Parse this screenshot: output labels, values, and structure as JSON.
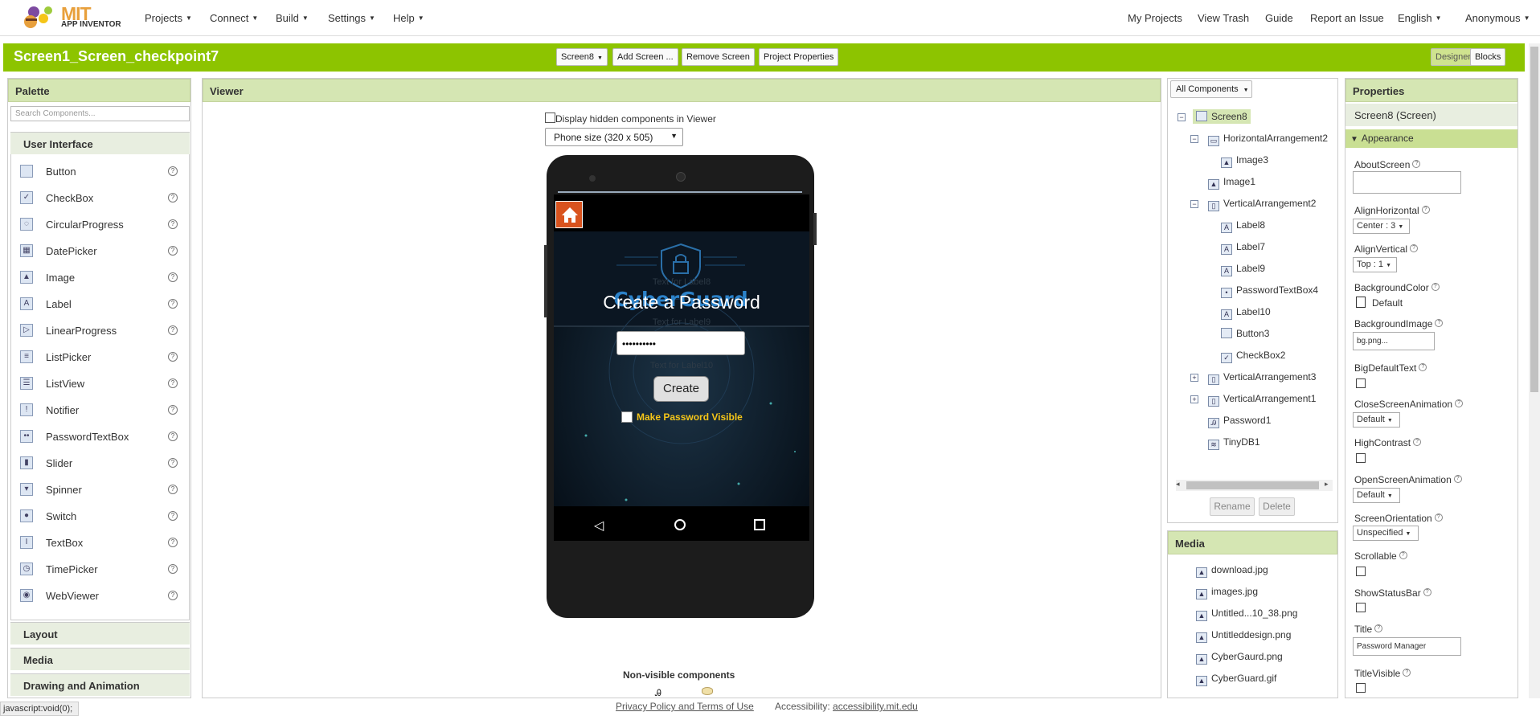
{
  "header": {
    "logo_mit": "MIT",
    "logo_subtitle": "APP INVENTOR",
    "menus": [
      "Projects",
      "Connect",
      "Build",
      "Settings",
      "Help"
    ],
    "right_links": [
      "My Projects",
      "View Trash",
      "Guide",
      "Report an Issue"
    ],
    "language": "English",
    "user": "Anonymous"
  },
  "project": {
    "title": "Screen1_Screen_checkpoint7",
    "screen_select": "Screen8",
    "add_screen": "Add Screen ...",
    "remove_screen": "Remove Screen",
    "project_properties": "Project Properties",
    "designer": "Designer",
    "blocks": "Blocks"
  },
  "palette": {
    "title": "Palette",
    "search_placeholder": "Search Components...",
    "category_open": "User Interface",
    "items": [
      {
        "label": "Button",
        "icon": "button-icon"
      },
      {
        "label": "CheckBox",
        "icon": "checkbox-icon"
      },
      {
        "label": "CircularProgress",
        "icon": "circular-progress-icon"
      },
      {
        "label": "DatePicker",
        "icon": "date-picker-icon"
      },
      {
        "label": "Image",
        "icon": "image-icon"
      },
      {
        "label": "Label",
        "icon": "label-icon"
      },
      {
        "label": "LinearProgress",
        "icon": "linear-progress-icon"
      },
      {
        "label": "ListPicker",
        "icon": "list-picker-icon"
      },
      {
        "label": "ListView",
        "icon": "list-view-icon"
      },
      {
        "label": "Notifier",
        "icon": "notifier-icon"
      },
      {
        "label": "PasswordTextBox",
        "icon": "password-textbox-icon"
      },
      {
        "label": "Slider",
        "icon": "slider-icon"
      },
      {
        "label": "Spinner",
        "icon": "spinner-icon"
      },
      {
        "label": "Switch",
        "icon": "switch-icon"
      },
      {
        "label": "TextBox",
        "icon": "textbox-icon"
      },
      {
        "label": "TimePicker",
        "icon": "time-picker-icon"
      },
      {
        "label": "WebViewer",
        "icon": "web-viewer-icon"
      }
    ],
    "categories_closed": [
      "Layout",
      "Media",
      "Drawing and Animation"
    ]
  },
  "viewer": {
    "title": "Viewer",
    "hidden_checkbox_label": "Display hidden components in Viewer",
    "size_select": "Phone size (320 x 505)",
    "non_visible_label": "Non-visible components"
  },
  "app_screen": {
    "brand": "CyberGuard",
    "faded_label_1": "Text for Label8",
    "heading": "Create a Password",
    "faded_label_2": "Text for Label9",
    "password_value": "••••••••••",
    "faded_label_3": "Text for Label10",
    "button": "Create",
    "checkbox_label": "Make Password Visible",
    "accent": "#f5c518"
  },
  "tree": {
    "filter": "All Components",
    "items": [
      {
        "label": "Screen8",
        "depth": 0,
        "toggle": "⊟",
        "icon": "screen-icon"
      },
      {
        "label": "HorizontalArrangement2",
        "depth": 1,
        "toggle": "⊟",
        "icon": "horizontal-arrangement-icon"
      },
      {
        "label": "Image3",
        "depth": 2,
        "toggle": "",
        "icon": "image-icon"
      },
      {
        "label": "Image1",
        "depth": 1,
        "toggle": "",
        "icon": "image-icon"
      },
      {
        "label": "VerticalArrangement2",
        "depth": 1,
        "toggle": "⊟",
        "icon": "vertical-arrangement-icon"
      },
      {
        "label": "Label8",
        "depth": 2,
        "toggle": "",
        "icon": "label-icon"
      },
      {
        "label": "Label7",
        "depth": 2,
        "toggle": "",
        "icon": "label-icon"
      },
      {
        "label": "Label9",
        "depth": 2,
        "toggle": "",
        "icon": "label-icon"
      },
      {
        "label": "PasswordTextBox4",
        "depth": 2,
        "toggle": "",
        "icon": "password-textbox-icon"
      },
      {
        "label": "Label10",
        "depth": 2,
        "toggle": "",
        "icon": "label-icon"
      },
      {
        "label": "Button3",
        "depth": 2,
        "toggle": "",
        "icon": "button-icon"
      },
      {
        "label": "CheckBox2",
        "depth": 2,
        "toggle": "",
        "icon": "checkbox-icon"
      },
      {
        "label": "VerticalArrangement3",
        "depth": 1,
        "toggle": "⊞",
        "icon": "vertical-arrangement-icon"
      },
      {
        "label": "VerticalArrangement1",
        "depth": 1,
        "toggle": "⊞",
        "icon": "vertical-arrangement-icon"
      },
      {
        "label": "Password1",
        "depth": 1,
        "toggle": "",
        "icon": "password-icon"
      },
      {
        "label": "TinyDB1",
        "depth": 1,
        "toggle": "",
        "icon": "tinydb-icon"
      }
    ],
    "rename": "Rename",
    "delete": "Delete"
  },
  "media": {
    "title": "Media",
    "files": [
      "download.jpg",
      "images.jpg",
      "Untitled...10_38.png",
      "Untitleddesign.png",
      "CyberGaurd.png",
      "CyberGuard.gif"
    ]
  },
  "properties": {
    "title": "Properties",
    "component": "Screen8 (Screen)",
    "section": "Appearance",
    "about_screen": "AboutScreen",
    "align_horizontal": "AlignHorizontal",
    "align_horizontal_value": "Center : 3",
    "align_vertical": "AlignVertical",
    "align_vertical_value": "Top : 1",
    "background_color": "BackgroundColor",
    "background_color_value": "Default",
    "background_image": "BackgroundImage",
    "background_image_value": "bg.png...",
    "big_default_text": "BigDefaultText",
    "close_screen_animation": "CloseScreenAnimation",
    "close_screen_animation_value": "Default",
    "high_contrast": "HighContrast",
    "open_screen_animation": "OpenScreenAnimation",
    "open_screen_animation_value": "Default",
    "screen_orientation": "ScreenOrientation",
    "screen_orientation_value": "Unspecified",
    "scrollable": "Scrollable",
    "show_status_bar": "ShowStatusBar",
    "title_label": "Title",
    "title_value": "Password Manager",
    "title_visible": "TitleVisible"
  },
  "footer": {
    "privacy": "Privacy Policy and Terms of Use",
    "accessibility_prefix": "Accessibility:",
    "accessibility_link": "accessibility.mit.edu",
    "status_text": "javascript:void(0);"
  },
  "colors": {
    "brand_green": "#8dc400",
    "panel_header": "#d5e6b3"
  }
}
